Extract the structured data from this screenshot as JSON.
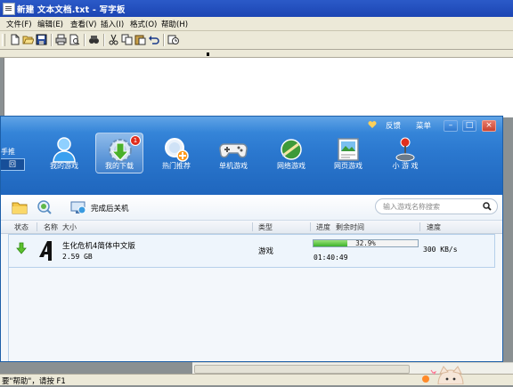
{
  "wordpad": {
    "title": "新建 文本文档.txt - 写字板",
    "menu": [
      "文件(F)",
      "编辑(E)",
      "查看(V)",
      "插入(I)",
      "格式(O)",
      "帮助(H)"
    ],
    "status_text": "要\"帮助\"，请按 F1"
  },
  "client": {
    "top_controls": {
      "feedback": "反馈",
      "menu": "菜单"
    },
    "window_buttons": {
      "minimize": "–",
      "maximize": "□",
      "close": "×"
    },
    "side_label": "手推",
    "side_button": "回",
    "tabs": [
      {
        "label": "我的游戏",
        "icon": "person-icon"
      },
      {
        "label": "我的下载",
        "icon": "download-gear-icon",
        "badge": "1",
        "active": true
      },
      {
        "label": "热门推荐",
        "icon": "magnifier-plus-icon"
      },
      {
        "label": "单机游戏",
        "icon": "gamepad-icon"
      },
      {
        "label": "网络游戏",
        "icon": "network-game-icon"
      },
      {
        "label": "网页游戏",
        "icon": "web-game-icon"
      },
      {
        "label": "小 游 戏",
        "icon": "joystick-icon"
      }
    ],
    "toolbar": {
      "shutdown_label": "完成后关机",
      "search_placeholder": "输入游戏名称搜索"
    },
    "columns": [
      "状态",
      "名称",
      "大小",
      "类型",
      "进度",
      "剩余时间",
      "速度"
    ],
    "downloads": [
      {
        "status_icon": "download-arrow-icon",
        "name": "生化危机4简体中文版",
        "size": "2.59 GB",
        "type": "游戏",
        "progress_label": "32.9%",
        "progress": 0.329,
        "time_left": "01:40:49",
        "speed": "300 KB/s"
      }
    ]
  }
}
